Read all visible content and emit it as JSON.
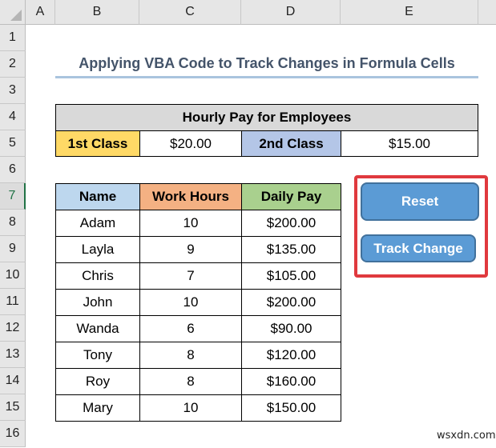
{
  "spreadsheet": {
    "columns": [
      "A",
      "B",
      "C",
      "D",
      "E"
    ],
    "rows": [
      "1",
      "2",
      "3",
      "4",
      "5",
      "6",
      "7",
      "8",
      "9",
      "10",
      "11",
      "12",
      "13",
      "14",
      "15",
      "16"
    ],
    "active_row": "7"
  },
  "title": "Applying VBA Code to Track Changes in Formula Cells",
  "hourly_pay": {
    "header": "Hourly Pay for Employees",
    "class1_label": "1st Class",
    "class1_value": "$20.00",
    "class2_label": "2nd Class",
    "class2_value": "$15.00"
  },
  "table": {
    "headers": [
      "Name",
      "Work Hours",
      "Daily Pay"
    ],
    "rows": [
      {
        "name": "Adam",
        "hours": "10",
        "pay": "$200.00"
      },
      {
        "name": "Layla",
        "hours": "9",
        "pay": "$135.00"
      },
      {
        "name": "Chris",
        "hours": "7",
        "pay": "$105.00"
      },
      {
        "name": "John",
        "hours": "10",
        "pay": "$200.00"
      },
      {
        "name": "Wanda",
        "hours": "6",
        "pay": "$90.00"
      },
      {
        "name": "Tony",
        "hours": "8",
        "pay": "$120.00"
      },
      {
        "name": "Roy",
        "hours": "8",
        "pay": "$160.00"
      },
      {
        "name": "Mary",
        "hours": "10",
        "pay": "$150.00"
      }
    ]
  },
  "buttons": {
    "reset": "Reset",
    "track_change": "Track Change"
  },
  "colors": {
    "header_gray": "#d9d9d9",
    "class1_yellow": "#ffd966",
    "class2_blue": "#b4c6e7",
    "name_header": "#bdd7ee",
    "hours_header": "#f4b183",
    "pay_header": "#a9d08e",
    "button_blue": "#5b9bd5",
    "highlight_red": "#e0393e"
  },
  "watermark": "wsxdn.com"
}
